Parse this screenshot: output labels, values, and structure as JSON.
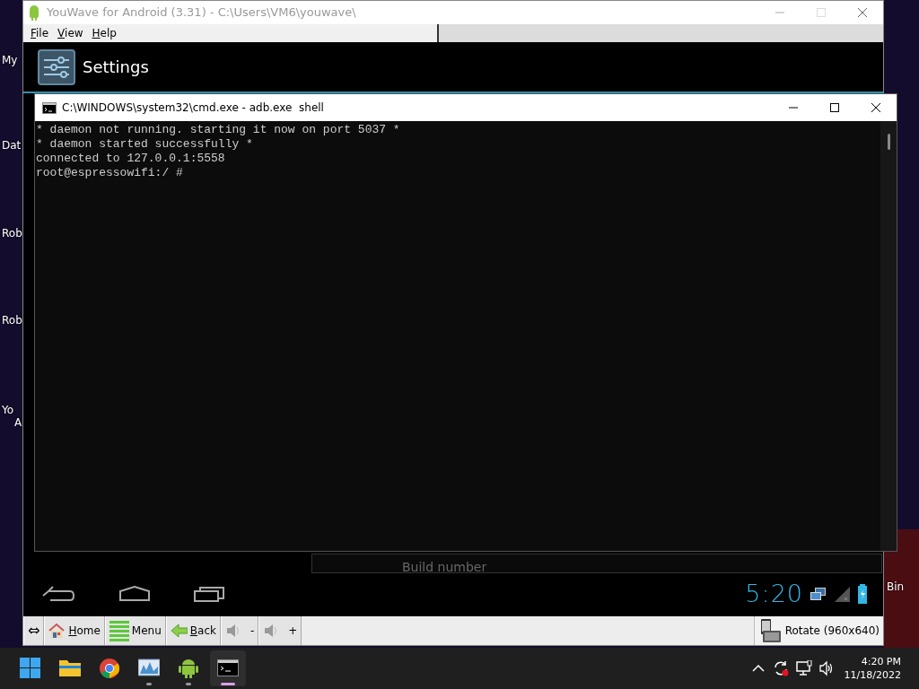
{
  "desktop": {
    "left_labels": [
      "My",
      "Dat",
      "Rob",
      "Rob",
      "Yo",
      "A"
    ],
    "right_labels": [
      "Bin"
    ]
  },
  "youwave": {
    "title": "YouWave for Android (3.31) - C:\\Users\\VM6\\youwave\\",
    "active": false,
    "menu": [
      {
        "label": "File",
        "underline_first": true
      },
      {
        "label": "View",
        "underline_first": true
      },
      {
        "label": "Help",
        "underline_first": true
      }
    ],
    "android": {
      "app_title": "Settings",
      "background_item": "Build number",
      "clock": "5:20"
    },
    "toolbar": [
      {
        "kind": "resize",
        "label": "⇔"
      },
      {
        "kind": "home",
        "label": "Home",
        "underline_first": true
      },
      {
        "kind": "menu",
        "label": "Menu",
        "underline_first": false
      },
      {
        "kind": "back",
        "label": "Back",
        "underline_first": true
      },
      {
        "kind": "volume",
        "label": "-"
      },
      {
        "kind": "volume",
        "label": "+"
      }
    ],
    "rotate": "Rotate (960x640)"
  },
  "cmd": {
    "title": "C:\\WINDOWS\\system32\\cmd.exe - adb.exe  shell",
    "active": true,
    "lines": [
      "* daemon not running. starting it now on port 5037 *",
      "* daemon started successfully *",
      "connected to 127.0.0.1:5558",
      "root@espressowifi:/ #"
    ]
  },
  "taskbar": {
    "apps": [
      {
        "kind": "start",
        "running": false,
        "selected": false
      },
      {
        "kind": "explorer",
        "running": false,
        "selected": false
      },
      {
        "kind": "chrome",
        "running": false,
        "selected": false
      },
      {
        "kind": "monitor",
        "running": true,
        "selected": false
      },
      {
        "kind": "android",
        "running": true,
        "selected": false
      },
      {
        "kind": "terminal",
        "running": true,
        "selected": true
      }
    ],
    "time": "4:20 PM",
    "date": "11/18/2022"
  }
}
